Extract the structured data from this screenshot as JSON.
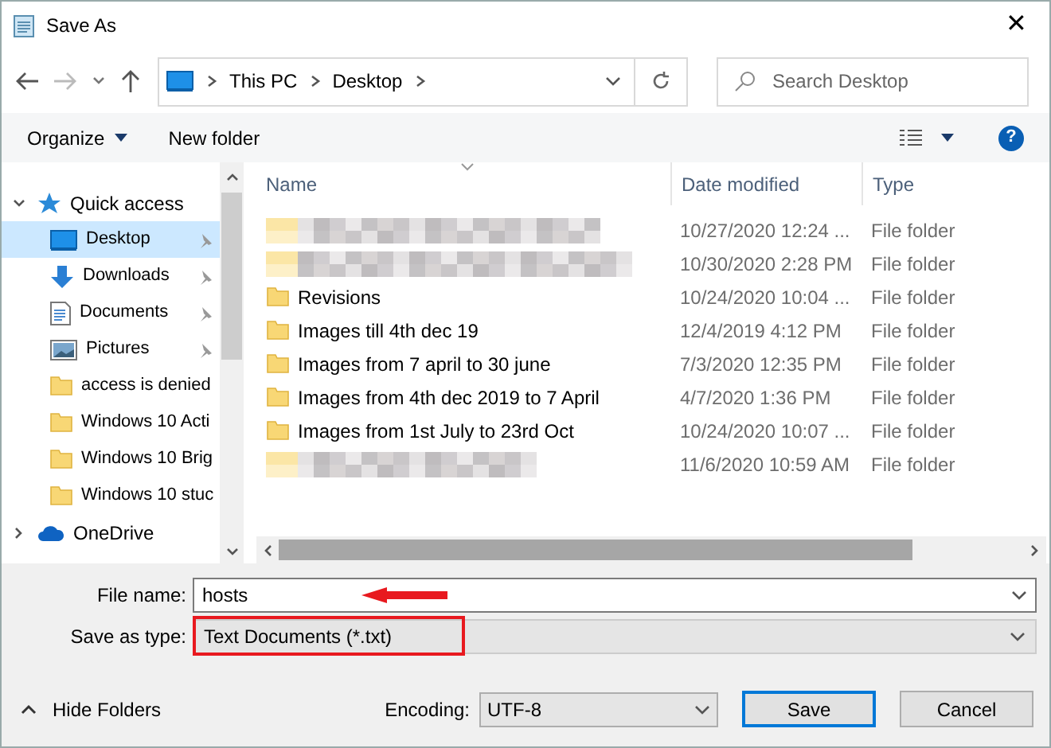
{
  "window": {
    "title": "Save As",
    "close": "✕"
  },
  "nav": {
    "path": [
      "This PC",
      "Desktop"
    ],
    "search_placeholder": "Search Desktop"
  },
  "toolbar": {
    "organize": "Organize",
    "new_folder": "New folder",
    "help": "?"
  },
  "sidebar": {
    "items": [
      {
        "label": "Quick access",
        "kind": "star",
        "expanded": true,
        "children": [
          {
            "label": "Desktop",
            "kind": "desktop",
            "selected": true,
            "pinned": true
          },
          {
            "label": "Downloads",
            "kind": "download",
            "selected": false,
            "pinned": true
          },
          {
            "label": "Documents",
            "kind": "document",
            "selected": false,
            "pinned": true
          },
          {
            "label": "Pictures",
            "kind": "picture",
            "selected": false,
            "pinned": true
          },
          {
            "label": "access is denied",
            "kind": "folder",
            "selected": false,
            "pinned": false
          },
          {
            "label": "Windows 10 Acti",
            "kind": "folder",
            "selected": false,
            "pinned": false
          },
          {
            "label": "Windows 10 Brig",
            "kind": "folder",
            "selected": false,
            "pinned": false
          },
          {
            "label": "Windows 10 stuc",
            "kind": "folder",
            "selected": false,
            "pinned": false
          }
        ]
      },
      {
        "label": "OneDrive",
        "kind": "cloud",
        "expanded": false
      }
    ]
  },
  "table": {
    "columns": [
      "Name",
      "Date modified",
      "Type"
    ],
    "rows": [
      {
        "kind": "blurred",
        "date": "10/27/2020 12:24 ...",
        "type": "File folder"
      },
      {
        "kind": "blurred",
        "date": "10/30/2020 2:28 PM",
        "type": "File folder"
      },
      {
        "kind": "folder",
        "name": "Revisions",
        "date": "10/24/2020 10:04 ...",
        "type": "File folder"
      },
      {
        "kind": "folder",
        "name": "Images till 4th dec 19",
        "date": "12/4/2019 4:12 PM",
        "type": "File folder"
      },
      {
        "kind": "folder",
        "name": "Images from 7 april to 30 june",
        "date": "7/3/2020 12:35 PM",
        "type": "File folder"
      },
      {
        "kind": "folder",
        "name": "Images from 4th dec 2019 to 7 April",
        "date": "4/7/2020 1:36 PM",
        "type": "File folder"
      },
      {
        "kind": "folder",
        "name": "Images from 1st July to 23rd Oct",
        "date": "10/24/2020 10:07 ...",
        "type": "File folder"
      },
      {
        "kind": "blurred",
        "date": "11/6/2020 10:59 AM",
        "type": "File folder"
      }
    ]
  },
  "form": {
    "file_name_label": "File name:",
    "file_name": "hosts",
    "type_label": "Save as type:",
    "type_value": "Text Documents (*.txt)",
    "hide_folders": "Hide Folders",
    "encoding_label": "Encoding:",
    "encoding": "UTF-8",
    "save": "Save",
    "cancel": "Cancel"
  }
}
